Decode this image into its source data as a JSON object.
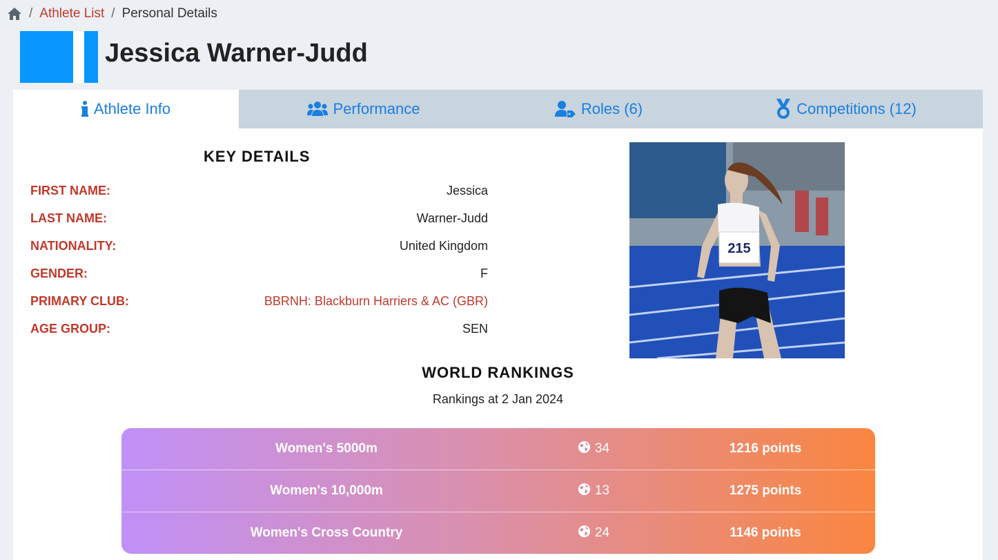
{
  "breadcrumb": {
    "home_icon": "home-icon",
    "items": [
      "Athlete List",
      "Personal Details"
    ],
    "separator": "/"
  },
  "athlete": {
    "name": "Jessica Warner-Judd",
    "flag_colors": [
      "#0a96ff",
      "#ffffff"
    ]
  },
  "tabs": [
    {
      "label": "Athlete Info",
      "icon": "info-icon"
    },
    {
      "label": "Performance",
      "icon": "users-icon"
    },
    {
      "label": "Roles (6)",
      "icon": "user-tag-icon"
    },
    {
      "label": "Competitions (12)",
      "icon": "medal-icon"
    }
  ],
  "key_details": {
    "title": "KEY DETAILS",
    "rows": [
      {
        "label": "FIRST NAME:",
        "value": "Jessica"
      },
      {
        "label": "LAST NAME:",
        "value": "Warner-Judd"
      },
      {
        "label": "NATIONALITY:",
        "value": "United Kingdom"
      },
      {
        "label": "GENDER:",
        "value": "F"
      },
      {
        "label": "PRIMARY CLUB:",
        "value": "BBRNH: Blackburn Harriers & AC (GBR)"
      },
      {
        "label": "AGE GROUP:",
        "value": "SEN"
      }
    ]
  },
  "world_rankings": {
    "title": "WORLD RANKINGS",
    "subtitle": "Rankings at 2 Jan 2024",
    "rows": [
      {
        "event": "Women's 5000m",
        "rank": "34",
        "points": "1216 points"
      },
      {
        "event": "Women's 10,000m",
        "rank": "13",
        "points": "1275 points"
      },
      {
        "event": "Women's Cross Country",
        "rank": "24",
        "points": "1146 points"
      }
    ]
  },
  "colors": {
    "accent_red": "#c0392b",
    "tab_blue": "#1a7fe0",
    "gradient_start": "#c090f7",
    "gradient_end": "#fa8640"
  }
}
